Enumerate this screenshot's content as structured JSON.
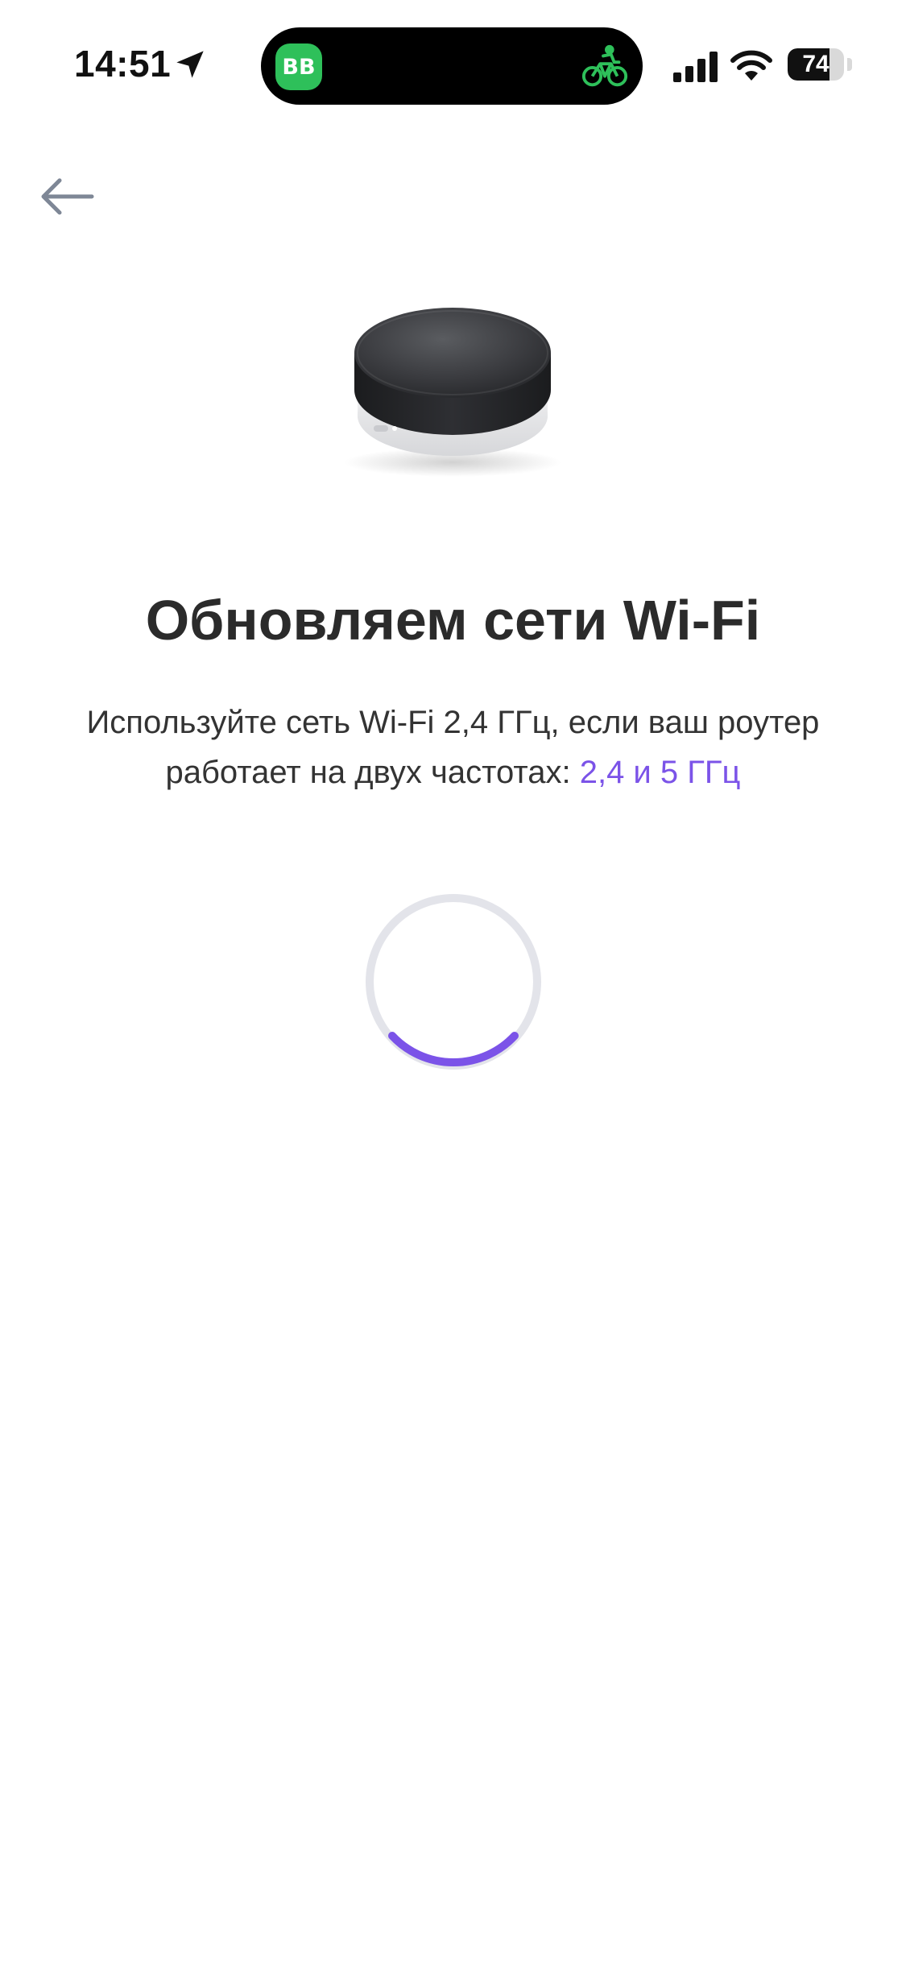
{
  "status_bar": {
    "time": "14:51",
    "app_badge": "BB",
    "battery": "74",
    "battery_level": 0.74,
    "icons": [
      "location-arrow-icon",
      "bike-icon",
      "cellular-signal-icon",
      "wifi-icon",
      "battery-icon"
    ]
  },
  "nav": {
    "back_icon": "arrow-left-icon"
  },
  "main": {
    "title": "Обновляем сети Wi-Fi",
    "subtitle_text": "Используйте сеть Wi-Fi 2,4 ГГц, если ваш роутер работает на двух частотах: ",
    "subtitle_link": "2,4 и 5 ГГц"
  },
  "colors": {
    "accent": "#7b53e8",
    "island_green": "#2ec05a",
    "spinner_track": "#e3e4ea"
  }
}
